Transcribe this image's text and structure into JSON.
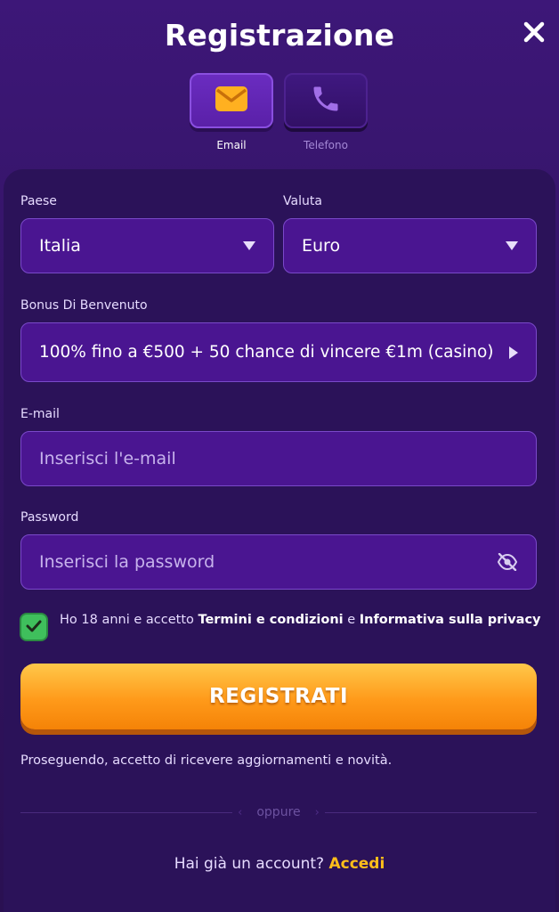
{
  "header": {
    "title": "Registrazione"
  },
  "tabs": [
    {
      "label": "Email",
      "icon": "envelope-icon",
      "active": true
    },
    {
      "label": "Telefono",
      "icon": "phone-icon",
      "active": false
    }
  ],
  "form": {
    "country": {
      "label": "Paese",
      "value": "Italia"
    },
    "currency": {
      "label": "Valuta",
      "value": "Euro"
    },
    "bonus": {
      "label": "Bonus Di Benvenuto",
      "value": "100% fino a €500 + 50 chance di vincere €1m (casino)"
    },
    "email": {
      "label": "E-mail",
      "placeholder": "Inserisci l'e-mail"
    },
    "password": {
      "label": "Password",
      "placeholder": "Inserisci la password"
    },
    "consent": {
      "checked": true,
      "prefix": "Ho 18 anni e accetto ",
      "terms": "Termini e condizioni",
      "middle": " e ",
      "privacy": "Informativa sulla privacy"
    },
    "submit_label": "REGISTRATI",
    "note": "Proseguendo, accetto di ricevere aggiornamenti e novità."
  },
  "divider": {
    "text": "oppure"
  },
  "footer": {
    "question": "Hai già un account?",
    "login_link": "Accedi"
  },
  "colors": {
    "background": "#341466",
    "panel": "#2b1259",
    "field": "#4a1591",
    "accent_orange": "#ff9a1a",
    "link_yellow": "#ffbe1a",
    "check_green": "#3fbf5c"
  }
}
